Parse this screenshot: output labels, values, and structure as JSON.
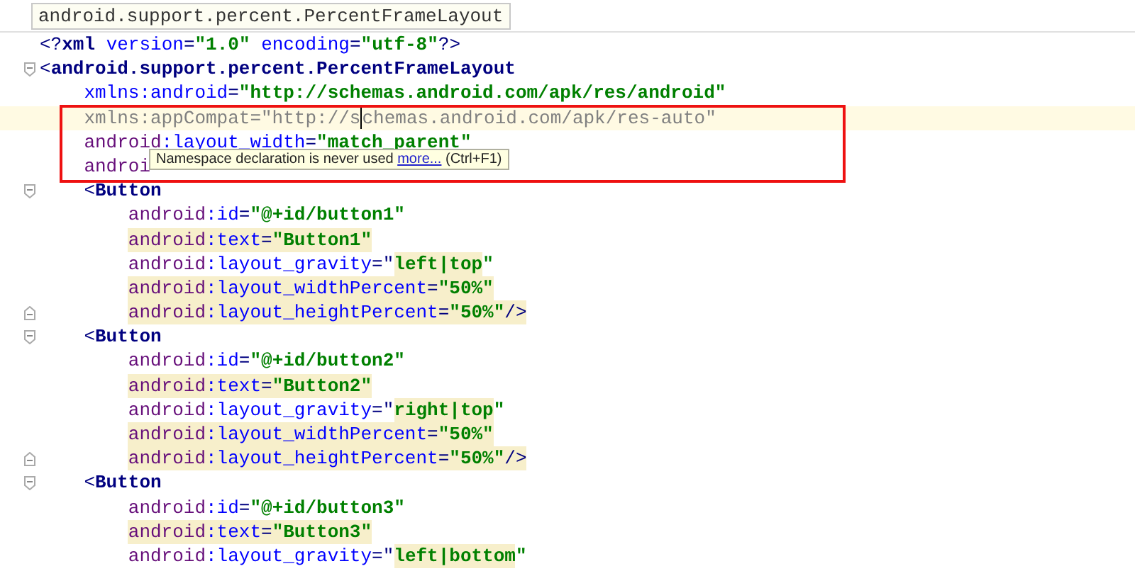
{
  "breadcrumb": "android.support.percent.PercentFrameLayout",
  "tooltip": {
    "text": "Namespace declaration is never used ",
    "link": "more...",
    "shortcut": "(Ctrl+F1)"
  },
  "lines": [
    {
      "kind": "plain",
      "current": false,
      "segments": [
        {
          "kind": "punct",
          "text": "<?",
          "highlighted": false
        },
        {
          "kind": "tag",
          "text": "xml",
          "highlighted": false
        },
        {
          "kind": "attr",
          "text": " version",
          "highlighted": false
        },
        {
          "kind": "punct",
          "text": "=",
          "highlighted": false
        },
        {
          "kind": "value",
          "text": "\"1.0\"",
          "highlighted": false
        },
        {
          "kind": "attr",
          "text": " encoding",
          "highlighted": false
        },
        {
          "kind": "punct",
          "text": "=",
          "highlighted": false
        },
        {
          "kind": "value",
          "text": "\"utf-8\"",
          "highlighted": false
        },
        {
          "kind": "punct",
          "text": "?>",
          "highlighted": false
        }
      ]
    },
    {
      "kind": "fold_start",
      "current": false,
      "segments": [
        {
          "kind": "punct",
          "text": "<",
          "highlighted": false
        },
        {
          "kind": "tag",
          "text": "android.support.percent.PercentFrameLayout",
          "highlighted": false
        }
      ],
      "children": [
        {
          "kind": "plain",
          "current": false,
          "segments": [
            {
              "kind": "attr",
              "text": "xmlns:android",
              "highlighted": false
            },
            {
              "kind": "punct",
              "text": "=",
              "highlighted": false
            },
            {
              "kind": "value",
              "text": "\"http://schemas.android.com/apk/res/android\"",
              "highlighted": false
            }
          ]
        },
        {
          "kind": "plain",
          "current": true,
          "segments": [
            {
              "kind": "unused",
              "text": "xmlns:appCompat=\"http://s",
              "highlighted": false
            },
            {
              "kind": "unused",
              "text": "chemas.android.com/apk/res-auto\"",
              "highlighted": false
            }
          ]
        },
        {
          "kind": "plain",
          "current": false,
          "segments": [
            {
              "kind": "ns",
              "text": "android",
              "highlighted": false
            },
            {
              "kind": "attr",
              "text": ":layout_width",
              "highlighted": false
            },
            {
              "kind": "punct",
              "text": "=",
              "highlighted": false
            },
            {
              "kind": "value",
              "text": "\"match_parent\"",
              "highlighted": false
            }
          ]
        },
        {
          "kind": "plain",
          "current": false,
          "segments": [
            {
              "kind": "ns",
              "text": "androi",
              "highlighted": false
            }
          ]
        },
        {
          "kind": "fold_start",
          "current": false,
          "segments": [
            {
              "kind": "punct",
              "text": "<",
              "highlighted": false
            },
            {
              "kind": "tag",
              "text": "Button",
              "highlighted": false
            }
          ],
          "children": [
            {
              "kind": "plain",
              "current": false,
              "segments": [
                {
                  "kind": "ns",
                  "text": "android",
                  "highlighted": false
                },
                {
                  "kind": "attr",
                  "text": ":id",
                  "highlighted": false
                },
                {
                  "kind": "punct",
                  "text": "=",
                  "highlighted": false
                },
                {
                  "kind": "value",
                  "text": "\"@+id/button1\"",
                  "highlighted": false
                }
              ]
            },
            {
              "kind": "plain",
              "current": false,
              "segments": [
                {
                  "kind": "ns",
                  "text": "android",
                  "highlighted": true
                },
                {
                  "kind": "attr",
                  "text": ":text",
                  "highlighted": true
                },
                {
                  "kind": "punct",
                  "text": "=",
                  "highlighted": true
                },
                {
                  "kind": "value",
                  "text": "\"Button1\"",
                  "highlighted": true
                }
              ]
            },
            {
              "kind": "plain",
              "current": false,
              "segments": [
                {
                  "kind": "ns",
                  "text": "android",
                  "highlighted": false
                },
                {
                  "kind": "attr",
                  "text": ":layout_gravity",
                  "highlighted": false
                },
                {
                  "kind": "punct",
                  "text": "=\"",
                  "highlighted": false
                },
                {
                  "kind": "value",
                  "text": "left|top",
                  "highlighted": true
                },
                {
                  "kind": "quote",
                  "text": "\"",
                  "highlighted": false
                }
              ]
            },
            {
              "kind": "plain",
              "current": false,
              "segments": [
                {
                  "kind": "ns",
                  "text": "android",
                  "highlighted": true
                },
                {
                  "kind": "attr",
                  "text": ":layout_widthPercent",
                  "highlighted": true
                },
                {
                  "kind": "punct",
                  "text": "=",
                  "highlighted": true
                },
                {
                  "kind": "value",
                  "text": "\"50%\"",
                  "highlighted": true
                }
              ]
            },
            {
              "kind": "fold_end",
              "current": false,
              "segments": [
                {
                  "kind": "ns",
                  "text": "android",
                  "highlighted": true
                },
                {
                  "kind": "attr",
                  "text": ":layout_heightPercent",
                  "highlighted": true
                },
                {
                  "kind": "punct",
                  "text": "=",
                  "highlighted": true
                },
                {
                  "kind": "value",
                  "text": "\"50%\"",
                  "highlighted": true
                },
                {
                  "kind": "punct",
                  "text": "/>",
                  "highlighted": true
                }
              ]
            }
          ]
        },
        {
          "kind": "fold_start",
          "current": false,
          "segments": [
            {
              "kind": "punct",
              "text": "<",
              "highlighted": false
            },
            {
              "kind": "tag",
              "text": "Button",
              "highlighted": false
            }
          ],
          "children": [
            {
              "kind": "plain",
              "current": false,
              "segments": [
                {
                  "kind": "ns",
                  "text": "android",
                  "highlighted": false
                },
                {
                  "kind": "attr",
                  "text": ":id",
                  "highlighted": false
                },
                {
                  "kind": "punct",
                  "text": "=",
                  "highlighted": false
                },
                {
                  "kind": "value",
                  "text": "\"@+id/button2\"",
                  "highlighted": false
                }
              ]
            },
            {
              "kind": "plain",
              "current": false,
              "segments": [
                {
                  "kind": "ns",
                  "text": "android",
                  "highlighted": true
                },
                {
                  "kind": "attr",
                  "text": ":text",
                  "highlighted": true
                },
                {
                  "kind": "punct",
                  "text": "=",
                  "highlighted": true
                },
                {
                  "kind": "value",
                  "text": "\"Button2\"",
                  "highlighted": true
                }
              ]
            },
            {
              "kind": "plain",
              "current": false,
              "segments": [
                {
                  "kind": "ns",
                  "text": "android",
                  "highlighted": false
                },
                {
                  "kind": "attr",
                  "text": ":layout_gravity",
                  "highlighted": false
                },
                {
                  "kind": "punct",
                  "text": "=\"",
                  "highlighted": false
                },
                {
                  "kind": "value",
                  "text": "right|top",
                  "highlighted": true
                },
                {
                  "kind": "quote",
                  "text": "\"",
                  "highlighted": false
                }
              ]
            },
            {
              "kind": "plain",
              "current": false,
              "segments": [
                {
                  "kind": "ns",
                  "text": "android",
                  "highlighted": true
                },
                {
                  "kind": "attr",
                  "text": ":layout_widthPercent",
                  "highlighted": true
                },
                {
                  "kind": "punct",
                  "text": "=",
                  "highlighted": true
                },
                {
                  "kind": "value",
                  "text": "\"50%\"",
                  "highlighted": true
                }
              ]
            },
            {
              "kind": "fold_end",
              "current": false,
              "segments": [
                {
                  "kind": "ns",
                  "text": "android",
                  "highlighted": true
                },
                {
                  "kind": "attr",
                  "text": ":layout_heightPercent",
                  "highlighted": true
                },
                {
                  "kind": "punct",
                  "text": "=",
                  "highlighted": true
                },
                {
                  "kind": "value",
                  "text": "\"50%\"",
                  "highlighted": true
                },
                {
                  "kind": "punct",
                  "text": "/>",
                  "highlighted": true
                }
              ]
            }
          ]
        },
        {
          "kind": "fold_start",
          "current": false,
          "segments": [
            {
              "kind": "punct",
              "text": "<",
              "highlighted": false
            },
            {
              "kind": "tag",
              "text": "Button",
              "highlighted": false
            }
          ],
          "children": [
            {
              "kind": "plain",
              "current": false,
              "segments": [
                {
                  "kind": "ns",
                  "text": "android",
                  "highlighted": false
                },
                {
                  "kind": "attr",
                  "text": ":id",
                  "highlighted": false
                },
                {
                  "kind": "punct",
                  "text": "=",
                  "highlighted": false
                },
                {
                  "kind": "value",
                  "text": "\"@+id/button3\"",
                  "highlighted": false
                }
              ]
            },
            {
              "kind": "plain",
              "current": false,
              "segments": [
                {
                  "kind": "ns",
                  "text": "android",
                  "highlighted": true
                },
                {
                  "kind": "attr",
                  "text": ":text",
                  "highlighted": true
                },
                {
                  "kind": "punct",
                  "text": "=",
                  "highlighted": true
                },
                {
                  "kind": "value",
                  "text": "\"Button3\"",
                  "highlighted": true
                }
              ]
            },
            {
              "kind": "plain",
              "current": false,
              "segments": [
                {
                  "kind": "ns",
                  "text": "android",
                  "highlighted": false
                },
                {
                  "kind": "attr",
                  "text": ":layout_gravity",
                  "highlighted": false
                },
                {
                  "kind": "punct",
                  "text": "=\"",
                  "highlighted": false
                },
                {
                  "kind": "value",
                  "text": "left|bottom",
                  "highlighted": true
                },
                {
                  "kind": "quote",
                  "text": "\"",
                  "highlighted": false
                }
              ]
            }
          ]
        }
      ]
    }
  ]
}
